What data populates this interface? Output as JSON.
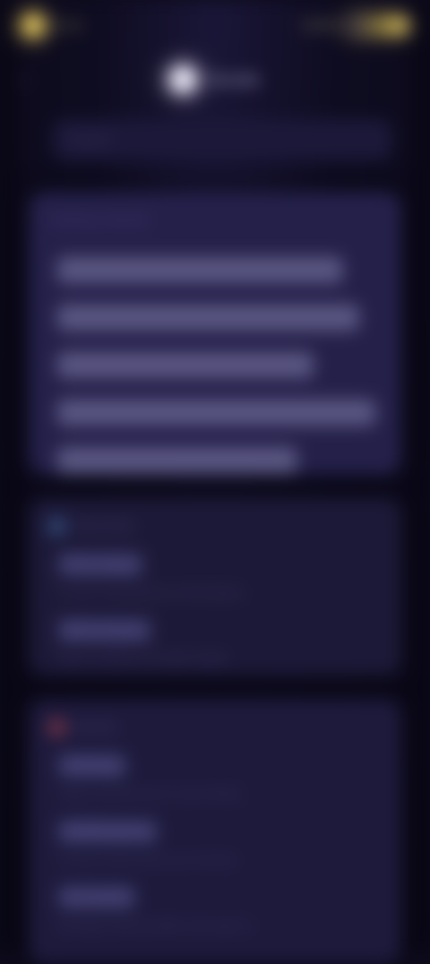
{
  "status": {
    "time": "9:41",
    "battery_label": "100%"
  },
  "header": {
    "back": "‹",
    "title": "Guide"
  },
  "search": {
    "placeholder": "Search"
  },
  "intro": {
    "heading": "Getting started",
    "lines": [
      "Welcome to your guide for the day ahead",
      "Tap any section below to read more about it",
      "Swipe left and right to move between",
      "chapters and use the search box to find topics",
      "quickly without leaving this screen."
    ]
  },
  "section_a": {
    "heading": "Overview",
    "items": [
      {
        "title": "First steps",
        "desc": "A short introduction to the basics"
      },
      {
        "title": "Next moves",
        "desc": "Tips on what to try after setup"
      }
    ]
  },
  "section_b": {
    "heading": "Details",
    "items": [
      {
        "title": "Settings",
        "desc": "Adjust preferences to your liking"
      },
      {
        "title": "Notifications",
        "desc": "Choose what alerts you receive"
      },
      {
        "title": "Accounts",
        "desc": "Manage linked profiles and sign-in"
      }
    ]
  },
  "colors": {
    "background": "#0d0b1c",
    "card": "#1e1b3b",
    "accent_gold": "#d9bd5a",
    "accent_blue": "#3c5a8c",
    "accent_red": "#8c3c4c"
  }
}
